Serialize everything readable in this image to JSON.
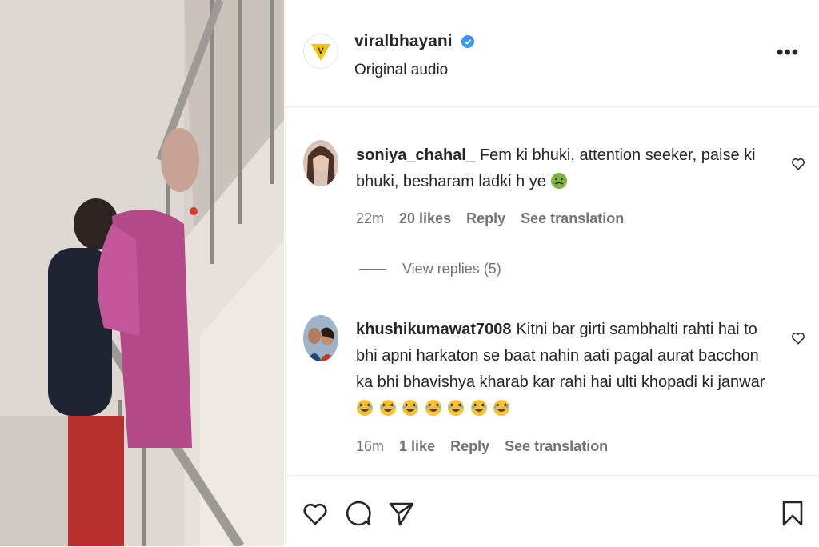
{
  "post": {
    "username": "viralbhayani",
    "audio": "Original audio",
    "more_label": "•••",
    "brand_color": "#f5c400",
    "verified_color": "#3897f0"
  },
  "comments": [
    {
      "user": "soniya_chahal_",
      "text": "Fem ki bhuki, attention seeker, paise ki bhuki, besharam ladki h ye",
      "emoji": [
        "nauseated-face"
      ],
      "time": "22m",
      "likes": "20 likes",
      "reply": "Reply",
      "translate": "See translation"
    },
    {
      "user": "khushikumawat7008",
      "text": "Kitni bar girti sambhalti rahti hai to bhi apni harkaton se baat nahin aati pagal aurat bacchon ka bhi bhavishya kharab kar rahi hai ulti khopadi ki janwar",
      "emoji": [
        "laughing-face",
        "laughing-face",
        "laughing-face",
        "laughing-face",
        "laughing-face",
        "laughing-face",
        "laughing-face"
      ],
      "time": "16m",
      "likes": "1 like",
      "reply": "Reply",
      "translate": "See translation"
    }
  ],
  "view_replies": "View replies (5)",
  "actions": [
    "heart-icon",
    "comment-icon",
    "share-icon",
    "bookmark-icon"
  ]
}
